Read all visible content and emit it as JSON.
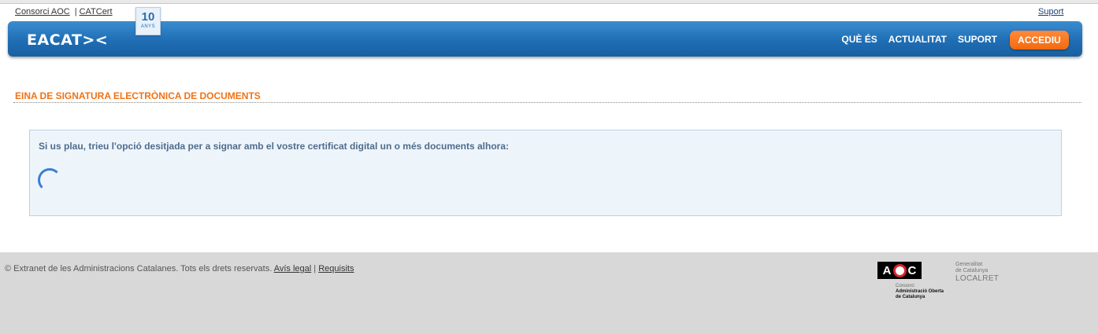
{
  "top": {
    "links": [
      "Consorci AOC",
      "CATCert"
    ],
    "separator": "|",
    "support_link": "Suport"
  },
  "badge": {
    "number": "10",
    "label": "ANYS"
  },
  "navbar": {
    "logo": "EACAT><",
    "items": [
      "QUÈ ÉS",
      "ACTUALITAT",
      "SUPORT"
    ],
    "login_button": "ACCEDIU"
  },
  "page": {
    "title": "EINA DE SIGNATURA ELECTRÒNICA DE DOCUMENTS",
    "prompt": "Si us plau, trieu l'opció desitjada per a signar amb el vostre certificat digital un o més documents alhora:"
  },
  "footer": {
    "copyright": "© Extranet de les Administracions Catalanes. Tots els drets reservats.",
    "links": [
      "Avís legal",
      "Requisits"
    ],
    "separator": "|",
    "aoc_logo": {
      "mark": "AOC",
      "line1": "Consorci",
      "line2": "Administració Oberta",
      "line3": "de Catalunya"
    },
    "gen_logo": {
      "line1": "Generalitat",
      "line2": "de Catalunya",
      "brand": "LOCALRET"
    }
  },
  "colors": {
    "accent": "#f07214",
    "nav": "#1f6eb5",
    "panel": "#eef5fa"
  }
}
